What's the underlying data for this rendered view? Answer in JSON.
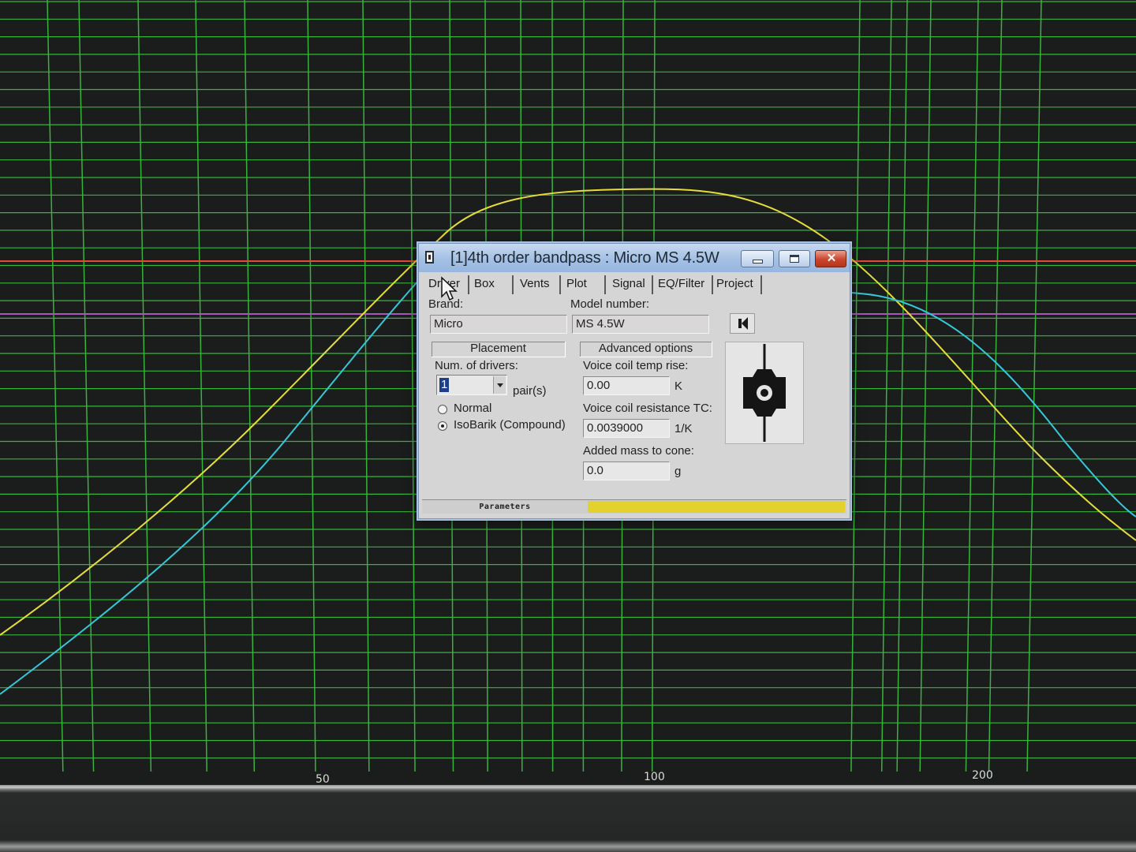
{
  "graph": {
    "colors": {
      "background": "#1b1d1c",
      "grid": "#38b43a",
      "reference_line": "#e24a3a",
      "secondary_line": "#a857b8",
      "series_yellow": "#e6dc3c",
      "series_cyan": "#35c8d8"
    },
    "x_ticks": [
      "50",
      "100",
      "200"
    ]
  },
  "dialog": {
    "title": "[1]4th order bandpass : Micro MS 4.5W",
    "tabs": [
      "Driver",
      "Box",
      "Vents",
      "Plot",
      "Signal",
      "EQ/Filter",
      "Project"
    ],
    "active_tab": "Driver",
    "brand": {
      "label": "Brand:",
      "value": "Micro"
    },
    "model": {
      "label": "Model number:",
      "value": "MS 4.5W"
    },
    "placement": {
      "heading": "Placement",
      "num_drivers_label": "Num. of drivers:",
      "num_drivers_value": "1",
      "unit": "pair(s)",
      "options": [
        "Normal",
        "IsoBarik (Compound)"
      ],
      "selected": "IsoBarik (Compound)"
    },
    "advanced": {
      "heading": "Advanced options",
      "voice_coil_temp_label": "Voice coil temp rise:",
      "voice_coil_temp_value": "0.00",
      "voice_coil_temp_unit": "K",
      "resistance_tc_label": "Voice coil resistance TC:",
      "resistance_tc_value": "0.0039000",
      "resistance_tc_unit": "1/K",
      "added_mass_label": "Added mass to cone:",
      "added_mass_value": "0.0",
      "added_mass_unit": "g"
    },
    "status": {
      "label": "Parameters"
    }
  }
}
